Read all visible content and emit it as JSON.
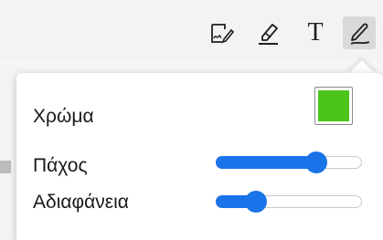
{
  "toolbar": {
    "tools": [
      {
        "name": "sign-tool",
        "icon": "signature-icon"
      },
      {
        "name": "highlight-tool",
        "icon": "highlighter-icon"
      },
      {
        "name": "text-tool",
        "icon": "text-icon",
        "glyph": "T"
      },
      {
        "name": "draw-tool",
        "icon": "pen-icon",
        "selected": true
      }
    ]
  },
  "panel": {
    "color_label": "Χρώμα",
    "color_value": "#4bc41c",
    "thickness_label": "Πάχος",
    "thickness_value": 0.69,
    "opacity_label": "Αδιαφάνεια",
    "opacity_value": 0.27
  },
  "colors": {
    "accent": "#1a73e8",
    "selected_tool_bg": "#d9d9d9"
  }
}
